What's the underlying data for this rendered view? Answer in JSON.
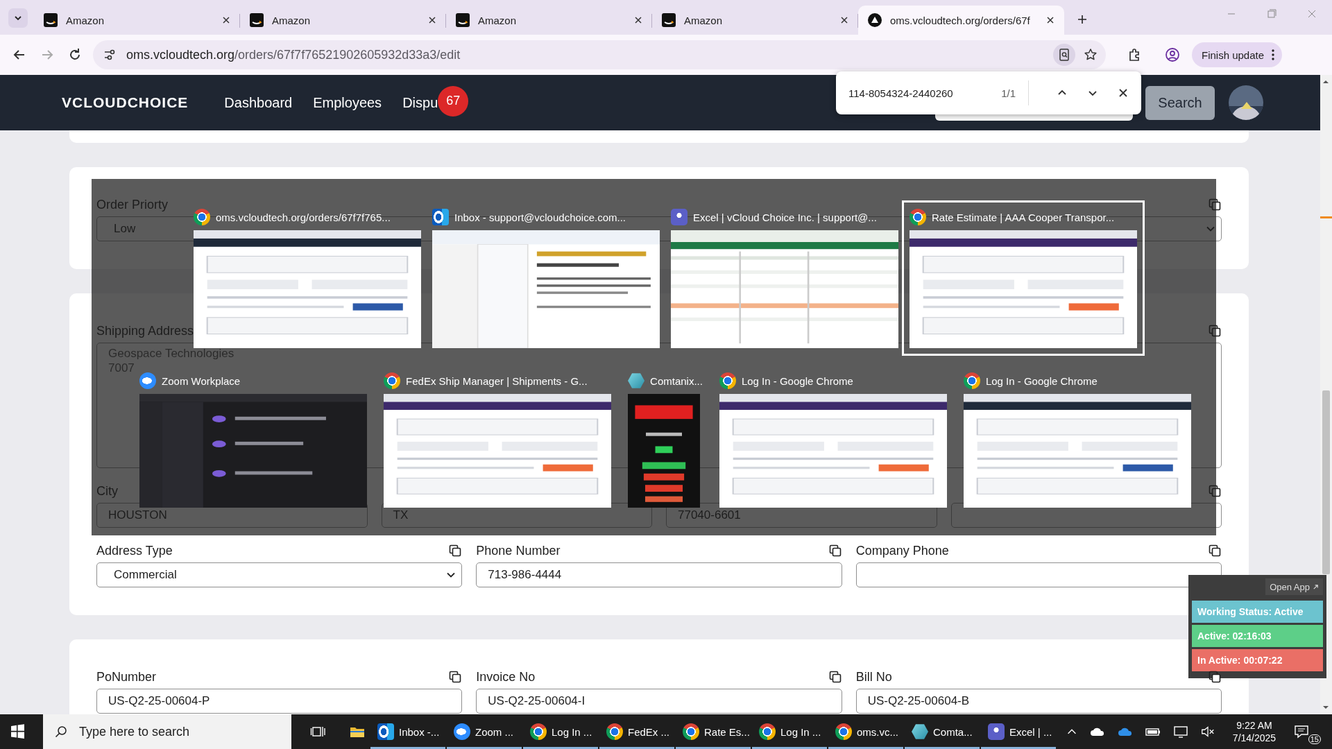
{
  "browser": {
    "tabs": [
      {
        "title": "Amazon",
        "kind": "amazon",
        "selected": false
      },
      {
        "title": "Amazon",
        "kind": "amazon",
        "selected": false
      },
      {
        "title": "Amazon",
        "kind": "amazon",
        "selected": false
      },
      {
        "title": "Amazon",
        "kind": "amazon",
        "selected": false
      },
      {
        "title": "oms.vcloudtech.org/orders/67f",
        "kind": "site",
        "selected": true
      }
    ],
    "url": {
      "host": "oms.vcloudtech.org",
      "path": "/orders/67f7f76521902605932d33a3/edit"
    },
    "update_button": "Finish update"
  },
  "find_bar": {
    "query": "114-8054324-2440260",
    "count": "1/1"
  },
  "navbar": {
    "logo": "VCLOUDCHOICE",
    "links": [
      "Dashboard",
      "Employees",
      "Dispu"
    ],
    "badge": "67",
    "search_button": "Search"
  },
  "sections": [
    {
      "rows": [
        [
          {
            "label": "Order Priorty",
            "kind": "select",
            "value": "Low",
            "copyable": true
          }
        ]
      ]
    },
    {
      "rows": [
        [
          {
            "label": "Shipping Address",
            "kind": "textarea",
            "lines": [
              "Geospace Technologies",
              "7007"
            ],
            "copyable": true
          }
        ],
        [
          {
            "label": "City",
            "kind": "text",
            "value": "HOUSTON",
            "copyable": false
          },
          {
            "kind": "text",
            "value": "TX",
            "copyable": false
          },
          {
            "kind": "text",
            "value": "77040-6601",
            "copyable": false
          },
          {
            "kind": "text",
            "copyable": true
          }
        ],
        [
          {
            "label": "Address Type",
            "kind": "select",
            "value": "Commercial",
            "copyable": true
          },
          {
            "label": "Phone Number",
            "kind": "text",
            "value": "713-986-4444",
            "copyable": true
          },
          {
            "label": "Company Phone",
            "kind": "text",
            "copyable": true
          }
        ]
      ]
    },
    {
      "rows": [
        [
          {
            "label": "PoNumber",
            "kind": "text",
            "value": "US-Q2-25-00604-P",
            "copyable": true
          },
          {
            "label": "Invoice No",
            "kind": "text",
            "value": "US-Q2-25-00604-I",
            "copyable": true
          },
          {
            "label": "Bill No",
            "kind": "text",
            "value": "US-Q2-25-00604-B",
            "copyable": true
          }
        ]
      ]
    }
  ],
  "task_switcher": {
    "windows": [
      {
        "title": "oms.vcloudtech.org/orders/67f7f765...",
        "kind": "chrome",
        "selected": false
      },
      {
        "title": "Inbox - support@vcloudchoice.com...",
        "kind": "outlook",
        "selected": false
      },
      {
        "title": "Excel | vCloud Choice Inc. | support@...",
        "kind": "teams",
        "selected": false
      },
      {
        "title": "Rate Estimate | AAA Cooper Transpor...",
        "kind": "chrome",
        "selected": true
      },
      {
        "title": "Zoom Workplace",
        "kind": "zoom",
        "selected": false
      },
      {
        "title": "FedEx Ship Manager | Shipments - G...",
        "kind": "chrome",
        "selected": false
      },
      {
        "title": "Comtanix...",
        "kind": "comtanix",
        "selected": false
      },
      {
        "title": "Log In - Google Chrome",
        "kind": "chrome",
        "selected": false
      },
      {
        "title": "Log In - Google Chrome",
        "kind": "chrome",
        "selected": false
      }
    ]
  },
  "status_widget": {
    "open_app": "Open App",
    "rows": [
      {
        "text": "Working Status: Active",
        "color": "#6cc3cf"
      },
      {
        "text": "Active: 02:16:03",
        "color": "#5dcf88"
      },
      {
        "text": "In Active: 00:07:22",
        "color": "#ea6f66"
      }
    ]
  },
  "taskbar": {
    "search_placeholder": "Type here to search",
    "apps": [
      {
        "kind": "outlook",
        "label": "Inbox -..."
      },
      {
        "kind": "zoom",
        "label": "Zoom ..."
      },
      {
        "kind": "chrome",
        "label": "Log In ..."
      },
      {
        "kind": "chrome",
        "label": "FedEx ..."
      },
      {
        "kind": "chrome",
        "label": "Rate Es..."
      },
      {
        "kind": "chrome",
        "label": "Log In ..."
      },
      {
        "kind": "chrome",
        "label": "oms.vc..."
      },
      {
        "kind": "comtanix",
        "label": "Comta..."
      },
      {
        "kind": "teams",
        "label": "Excel | ..."
      }
    ],
    "time": "9:22 AM",
    "date": "7/14/2025",
    "notifications": "15"
  }
}
